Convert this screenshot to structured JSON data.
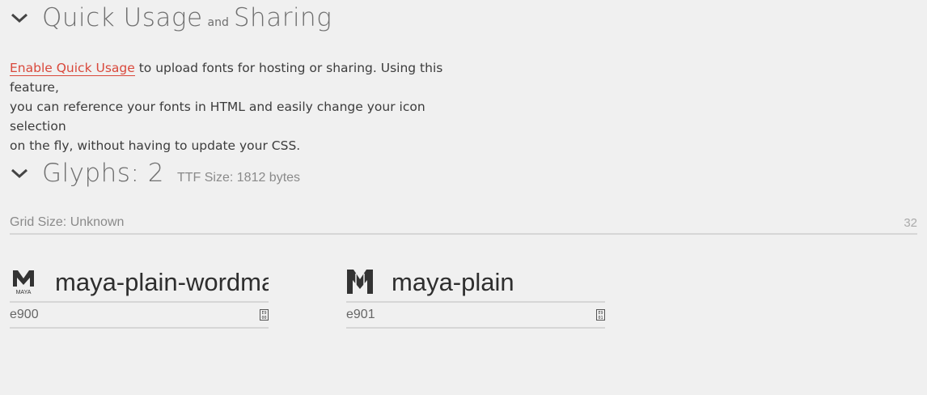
{
  "quick_usage": {
    "title_part1": "Quick Usage",
    "title_and": "and",
    "title_part2": "Sharing",
    "link_text": "Enable Quick Usage",
    "body_line1": " to upload fonts for hosting or sharing. Using this feature,",
    "body_line2": "you can reference your fonts in HTML and easily change your icon selection",
    "body_line3": "on the fly, without having to update your CSS."
  },
  "glyphs_section": {
    "title": "Glyphs: 2",
    "ttf_size": "TTF Size: 1812 bytes",
    "grid_size_label": "Grid Size: Unknown",
    "grid_size_value": "32"
  },
  "glyphs": [
    {
      "name": "maya-plain-wordmark",
      "code": "e900",
      "icon_wordmark_text": "MAYA"
    },
    {
      "name": "maya-plain",
      "code": "e901"
    }
  ],
  "icons": {
    "collapse": "chevron-down-icon",
    "glyph_1": "maya-wordmark-icon",
    "glyph_2": "maya-icon",
    "code_button": "hex-code-icon"
  },
  "colors": {
    "link": "#d9483b",
    "background": "#f0f0f0",
    "divider": "#d6d6d6"
  }
}
